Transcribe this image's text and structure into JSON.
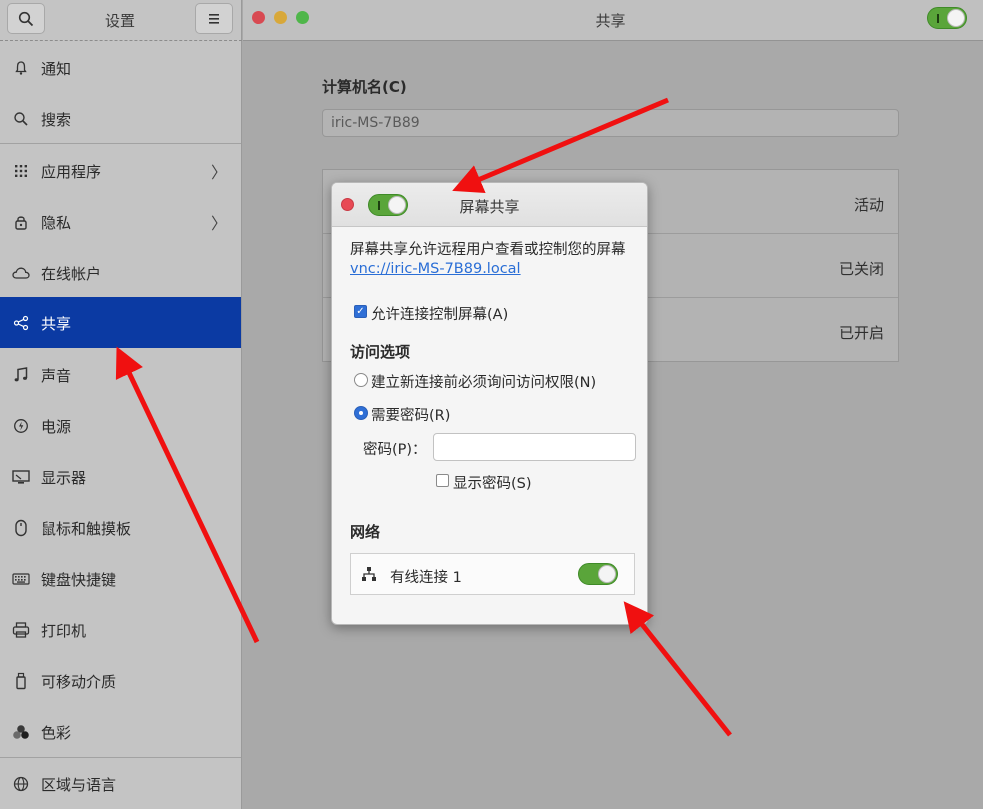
{
  "sidebar": {
    "title": "设置",
    "items": [
      {
        "label": "通知",
        "icon": "bell-icon"
      },
      {
        "label": "搜索",
        "icon": "search-icon"
      },
      {
        "label": "应用程序",
        "icon": "apps-grid-icon"
      },
      {
        "label": "隐私",
        "icon": "lock-icon"
      },
      {
        "label": "在线帐户",
        "icon": "cloud-icon"
      },
      {
        "label": "共享",
        "icon": "share-icon"
      },
      {
        "label": "声音",
        "icon": "music-note-icon"
      },
      {
        "label": "电源",
        "icon": "power-icon"
      },
      {
        "label": "显示器",
        "icon": "display-icon"
      },
      {
        "label": "鼠标和触摸板",
        "icon": "mouse-icon"
      },
      {
        "label": "键盘快捷键",
        "icon": "keyboard-icon"
      },
      {
        "label": "打印机",
        "icon": "printer-icon"
      },
      {
        "label": "可移动介质",
        "icon": "removable-media-icon"
      },
      {
        "label": "色彩",
        "icon": "color-icon"
      },
      {
        "label": "区域与语言",
        "icon": "globe-icon"
      }
    ]
  },
  "main": {
    "title": "共享",
    "computer_name_label": "计算机名(C)",
    "computer_name_value": "iric-MS-7B89",
    "rows": [
      {
        "status": "活动"
      },
      {
        "status": "已关闭"
      },
      {
        "status": "已开启"
      }
    ]
  },
  "dialog": {
    "title": "屏幕共享",
    "description": "屏幕共享允许远程用户查看或控制您的屏幕",
    "link": "vnc://iric-MS-7B89.local",
    "allow_control": "允许连接控制屏幕(A)",
    "access_title": "访问选项",
    "option_ask": "建立新连接前必须询问访问权限(N)",
    "option_password": "需要密码(R)",
    "password_label": "密码(P)：",
    "show_password": "显示密码(S)",
    "network_title": "网络",
    "network_item": "有线连接 1"
  },
  "colors": {
    "accent": "#0b3aa3",
    "toggle_on": "#5aa53a",
    "arrow": "#f01010",
    "link": "#2a6ed6"
  }
}
